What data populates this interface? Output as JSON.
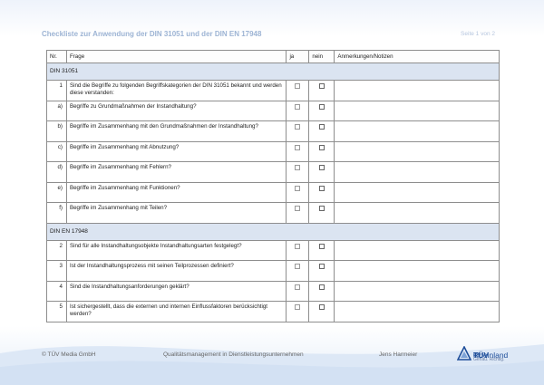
{
  "header": {
    "title": "Checkliste zur Anwendung der DIN 31051 und der DIN EN 17948",
    "page": "Seite 1 von 2"
  },
  "table": {
    "columns": {
      "nr": "Nr.",
      "frage": "Frage",
      "ja": "ja",
      "nein": "nein",
      "notes": "Anmerkungen/Notizen"
    },
    "sections": [
      {
        "title": "DIN 31051",
        "rows": [
          {
            "nr": "1",
            "frage": "Sind die Begriffe zu folgenden Begriffskategorien der DIN 31051 bekannt und werden diese verstanden:"
          },
          {
            "nr": "a)",
            "frage": "Begriffe zu Grundmaßnahmen der Instandhaltung?"
          },
          {
            "nr": "b)",
            "frage": "Begriffe im Zusammenhang mit den Grundmaßnahmen der Instandhaltung?"
          },
          {
            "nr": "c)",
            "frage": "Begriffe im Zusammenhang mit Abnutzung?"
          },
          {
            "nr": "d)",
            "frage": "Begriffe im Zusammenhang mit Fehlern?"
          },
          {
            "nr": "e)",
            "frage": "Begriffe im Zusammenhang mit Funktionen?"
          },
          {
            "nr": "f)",
            "frage": "Begriffe im Zusammenhang mit Teilen?"
          }
        ]
      },
      {
        "title": "DIN EN 17948",
        "rows": [
          {
            "nr": "2",
            "frage": "Sind für alle Instandhaltungsobjekte Instandhaltungsarten festgelegt?"
          },
          {
            "nr": "3",
            "frage": "Ist der Instandhaltungsprozess mit seinen Teilprozessen definiert?"
          },
          {
            "nr": "4",
            "frage": "Sind die Instandhaltungsanforderungen geklärt?"
          },
          {
            "nr": "5",
            "frage": "Ist sichergestellt, dass die externen und internen Einflussfaktoren berücksichtigt werden?"
          }
        ]
      }
    ]
  },
  "footer": {
    "copyright": "© TÜV Media GmbH",
    "center": "Qualitätsmanagement in Dienstleistungsunternehmen",
    "author": "Jens Harmeier",
    "logo_name_bold": "TÜV",
    "logo_name_thin": "Rheinland",
    "logo_trademark": "®",
    "logo_slogan": "Genau. Richtig."
  },
  "colors": {
    "accent": "#1e4e9a",
    "section_bg": "#dbe4f1",
    "title_color": "#9db4d4"
  }
}
